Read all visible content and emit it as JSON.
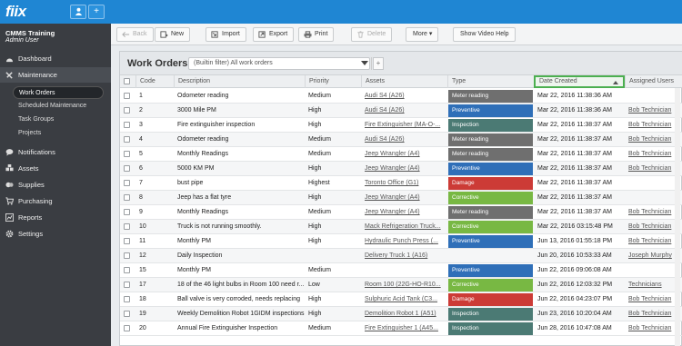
{
  "topbar": {
    "logo": "fiix",
    "user_icon": "user-icon",
    "add_icon": "plus-icon"
  },
  "sidebar": {
    "org": "CMMS Training",
    "user": "Admin User",
    "items": [
      {
        "label": "Dashboard",
        "icon": "dashboard-icon"
      },
      {
        "label": "Maintenance",
        "icon": "wrench-icon"
      },
      {
        "label": "Notifications",
        "icon": "chat-icon"
      },
      {
        "label": "Assets",
        "icon": "boxes-icon"
      },
      {
        "label": "Supplies",
        "icon": "supplies-icon"
      },
      {
        "label": "Purchasing",
        "icon": "cart-icon"
      },
      {
        "label": "Reports",
        "icon": "chart-icon"
      },
      {
        "label": "Settings",
        "icon": "gear-icon"
      }
    ],
    "sub_items": [
      "Work Orders",
      "Scheduled Maintenance",
      "Task Groups",
      "Projects"
    ]
  },
  "toolbar": {
    "back": "Back",
    "new": "New",
    "import": "Import",
    "export": "Export",
    "print": "Print",
    "delete": "Delete",
    "more": "More ▾",
    "video": "Show Video Help"
  },
  "panel": {
    "title": "Work Orders",
    "filter_text": "(Builtin filter) All work orders",
    "filter_add": "+"
  },
  "columns": [
    "Code",
    "Description",
    "Priority",
    "Assets",
    "Type",
    "Date Created",
    "Assigned Users"
  ],
  "type_colors": {
    "Meter reading": "#6f6f6f",
    "Preventive": "#2f6fb8",
    "Inspection": "#4b7a74",
    "Damage": "#cc3b36",
    "Corrective": "#78b843"
  },
  "rows": [
    {
      "code": "1",
      "description": "Odometer reading",
      "priority": "Medium",
      "asset": "Audi S4 (A26)",
      "type": "Meter reading",
      "date": "Mar 22, 2016 11:38:36 AM",
      "assigned": ""
    },
    {
      "code": "2",
      "description": "3000 Mile PM",
      "priority": "High",
      "asset": "Audi S4 (A26)",
      "type": "Preventive",
      "date": "Mar 22, 2016 11:38:36 AM",
      "assigned": "Bob Technician"
    },
    {
      "code": "3",
      "description": "Fire extinguisher inspection",
      "priority": "High",
      "asset": "Fire Extinguisher (MA-O-...",
      "type": "Inspection",
      "date": "Mar 22, 2016 11:38:37 AM",
      "assigned": "Bob Technician"
    },
    {
      "code": "4",
      "description": "Odometer reading",
      "priority": "Medium",
      "asset": "Audi S4 (A26)",
      "type": "Meter reading",
      "date": "Mar 22, 2016 11:38:37 AM",
      "assigned": "Bob Technician"
    },
    {
      "code": "5",
      "description": "Monthly Readings",
      "priority": "Medium",
      "asset": "Jeep Wrangler (A4)",
      "type": "Meter reading",
      "date": "Mar 22, 2016 11:38:37 AM",
      "assigned": "Bob Technician"
    },
    {
      "code": "6",
      "description": "5000 KM PM",
      "priority": "High",
      "asset": "Jeep Wrangler (A4)",
      "type": "Preventive",
      "date": "Mar 22, 2016 11:38:37 AM",
      "assigned": "Bob Technician"
    },
    {
      "code": "7",
      "description": "bust pipe",
      "priority": "Highest",
      "asset": "Toronto Office (G1)",
      "type": "Damage",
      "date": "Mar 22, 2016 11:38:37 AM",
      "assigned": ""
    },
    {
      "code": "8",
      "description": "Jeep has a flat tyre",
      "priority": "High",
      "asset": "Jeep Wrangler (A4)",
      "type": "Corrective",
      "date": "Mar 22, 2016 11:38:37 AM",
      "assigned": ""
    },
    {
      "code": "9",
      "description": "Monthly Readings",
      "priority": "Medium",
      "asset": "Jeep Wrangler (A4)",
      "type": "Meter reading",
      "date": "Mar 22, 2016 11:38:37 AM",
      "assigned": "Bob Technician"
    },
    {
      "code": "10",
      "description": "Truck is not running smoothly.",
      "priority": "High",
      "asset": "Mack Refrigeration Truck...",
      "type": "Corrective",
      "date": "Mar 22, 2016 03:15:48 PM",
      "assigned": "Bob Technician"
    },
    {
      "code": "11",
      "description": "Monthly PM",
      "priority": "High",
      "asset": "Hydraulic Punch Press (...",
      "type": "Preventive",
      "date": "Jun 13, 2016 01:55:18 PM",
      "assigned": "Bob Technician"
    },
    {
      "code": "12",
      "description": "Daily Inspection",
      "priority": "",
      "asset": "Delivery Truck 1 (A16)",
      "type": "",
      "date": "Jun 20, 2016 10:53:33 AM",
      "assigned": "Joseph Murphy"
    },
    {
      "code": "15",
      "description": "Monthly PM",
      "priority": "Medium",
      "asset": "",
      "type": "Preventive",
      "date": "Jun 22, 2016 09:06:08 AM",
      "assigned": ""
    },
    {
      "code": "17",
      "description": "18 of the 46 light bulbs in Room 100 need r...",
      "priority": "Low",
      "asset": "Room 100 (22G-HO-R10...",
      "type": "Corrective",
      "date": "Jun 22, 2016 12:03:32 PM",
      "assigned": "Technicians"
    },
    {
      "code": "18",
      "description": "Ball valve is very corroded, needs replacing",
      "priority": "High",
      "asset": "Sulphuric Acid Tank (C3...",
      "type": "Damage",
      "date": "Jun 22, 2016 04:23:07 PM",
      "assigned": "Bob Technician"
    },
    {
      "code": "19",
      "description": "Weekly Demolition Robot 1GIDM inspections",
      "priority": "High",
      "asset": "Demolition Robot 1 (A51)",
      "type": "Inspection",
      "date": "Jun 23, 2016 10:20:04 AM",
      "assigned": "Bob Technician"
    },
    {
      "code": "20",
      "description": "Annual Fire Extinguisher Inspection",
      "priority": "Medium",
      "asset": "Fire Extinguisher 1 (A45...",
      "type": "Inspection",
      "date": "Jun 28, 2016 10:47:08 AM",
      "assigned": "Bob Technician"
    }
  ]
}
